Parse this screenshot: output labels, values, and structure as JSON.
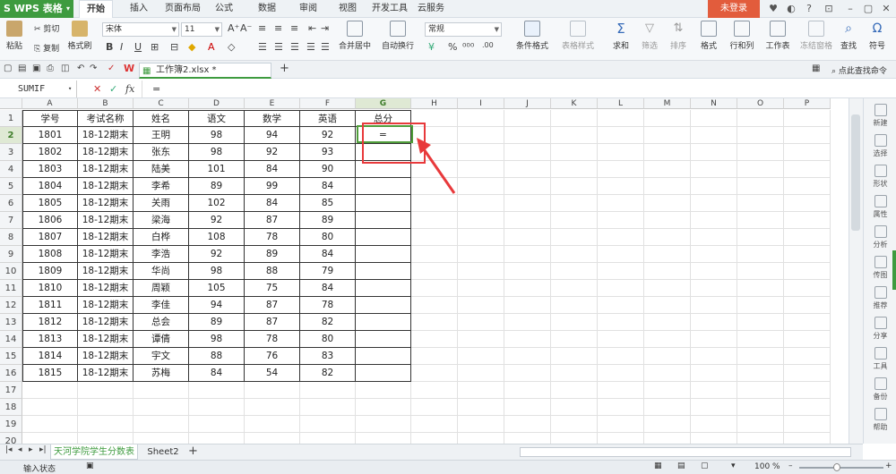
{
  "app": {
    "name": "WPS 表格",
    "login_label": "未登录"
  },
  "menus": [
    "开始",
    "插入",
    "页面布局",
    "公式",
    "数据",
    "审阅",
    "视图",
    "开发工具",
    "云服务"
  ],
  "ribbon": {
    "paste": "粘贴",
    "cut": "剪切",
    "copy": "复制",
    "format_painter": "格式刷",
    "font_name": "宋体",
    "font_size": "11",
    "merge_center": "合并居中",
    "wrap_text": "自动换行",
    "number_format": "常规",
    "cond_format": "条件格式",
    "table_style": "表格样式",
    "sum": "求和",
    "filter": "筛选",
    "sort": "排序",
    "format": "格式",
    "row_col": "行和列",
    "worksheet": "工作表",
    "freeze": "冻结窗格",
    "find": "查找",
    "symbol": "符号"
  },
  "document": {
    "tab_title": "工作簿2.xlsx *",
    "search_command": "点此查找命令"
  },
  "formula_bar": {
    "name_box": "SUMIF",
    "fx": "fx",
    "content": "="
  },
  "columns": [
    "A",
    "B",
    "C",
    "D",
    "E",
    "F",
    "G",
    "H",
    "I",
    "J",
    "K",
    "L",
    "M",
    "N",
    "O",
    "P"
  ],
  "headers": [
    "学号",
    "考试名称",
    "姓名",
    "语文",
    "数学",
    "英语",
    "总分"
  ],
  "rows": [
    [
      "1801",
      "18-12期末",
      "王明",
      "98",
      "94",
      "92",
      "="
    ],
    [
      "1802",
      "18-12期末",
      "张东",
      "98",
      "92",
      "93",
      ""
    ],
    [
      "1803",
      "18-12期末",
      "陆美",
      "101",
      "84",
      "90",
      ""
    ],
    [
      "1804",
      "18-12期末",
      "李希",
      "89",
      "99",
      "84",
      ""
    ],
    [
      "1805",
      "18-12期末",
      "关雨",
      "102",
      "84",
      "85",
      ""
    ],
    [
      "1806",
      "18-12期末",
      "梁海",
      "92",
      "87",
      "89",
      ""
    ],
    [
      "1807",
      "18-12期末",
      "白桦",
      "108",
      "78",
      "80",
      ""
    ],
    [
      "1808",
      "18-12期末",
      "李浩",
      "92",
      "89",
      "84",
      ""
    ],
    [
      "1809",
      "18-12期末",
      "华尚",
      "98",
      "88",
      "79",
      ""
    ],
    [
      "1810",
      "18-12期末",
      "周颖",
      "105",
      "75",
      "84",
      ""
    ],
    [
      "1811",
      "18-12期末",
      "李佳",
      "94",
      "87",
      "78",
      ""
    ],
    [
      "1812",
      "18-12期末",
      "总会",
      "89",
      "87",
      "82",
      ""
    ],
    [
      "1813",
      "18-12期末",
      "谭倩",
      "98",
      "78",
      "80",
      ""
    ],
    [
      "1814",
      "18-12期末",
      "宇文",
      "88",
      "76",
      "83",
      ""
    ],
    [
      "1815",
      "18-12期末",
      "苏梅",
      "84",
      "54",
      "82",
      ""
    ]
  ],
  "row_numbers": [
    "1",
    "2",
    "3",
    "4",
    "5",
    "6",
    "7",
    "8",
    "9",
    "10",
    "11",
    "12",
    "13",
    "14",
    "15",
    "16",
    "17",
    "18",
    "19",
    "20"
  ],
  "sheets": [
    "天河学院学生分数表",
    "Sheet2"
  ],
  "right_panel": [
    "新建",
    "选择",
    "形状",
    "属性",
    "分析",
    "传图",
    "推荐",
    "分享",
    "工具",
    "备份",
    "帮助"
  ],
  "status": {
    "mode": "输入状态",
    "zoom": "100 %"
  },
  "colors": {
    "accent": "#3e9b3f",
    "login": "#e25c3c",
    "annotation": "#e8393b"
  }
}
